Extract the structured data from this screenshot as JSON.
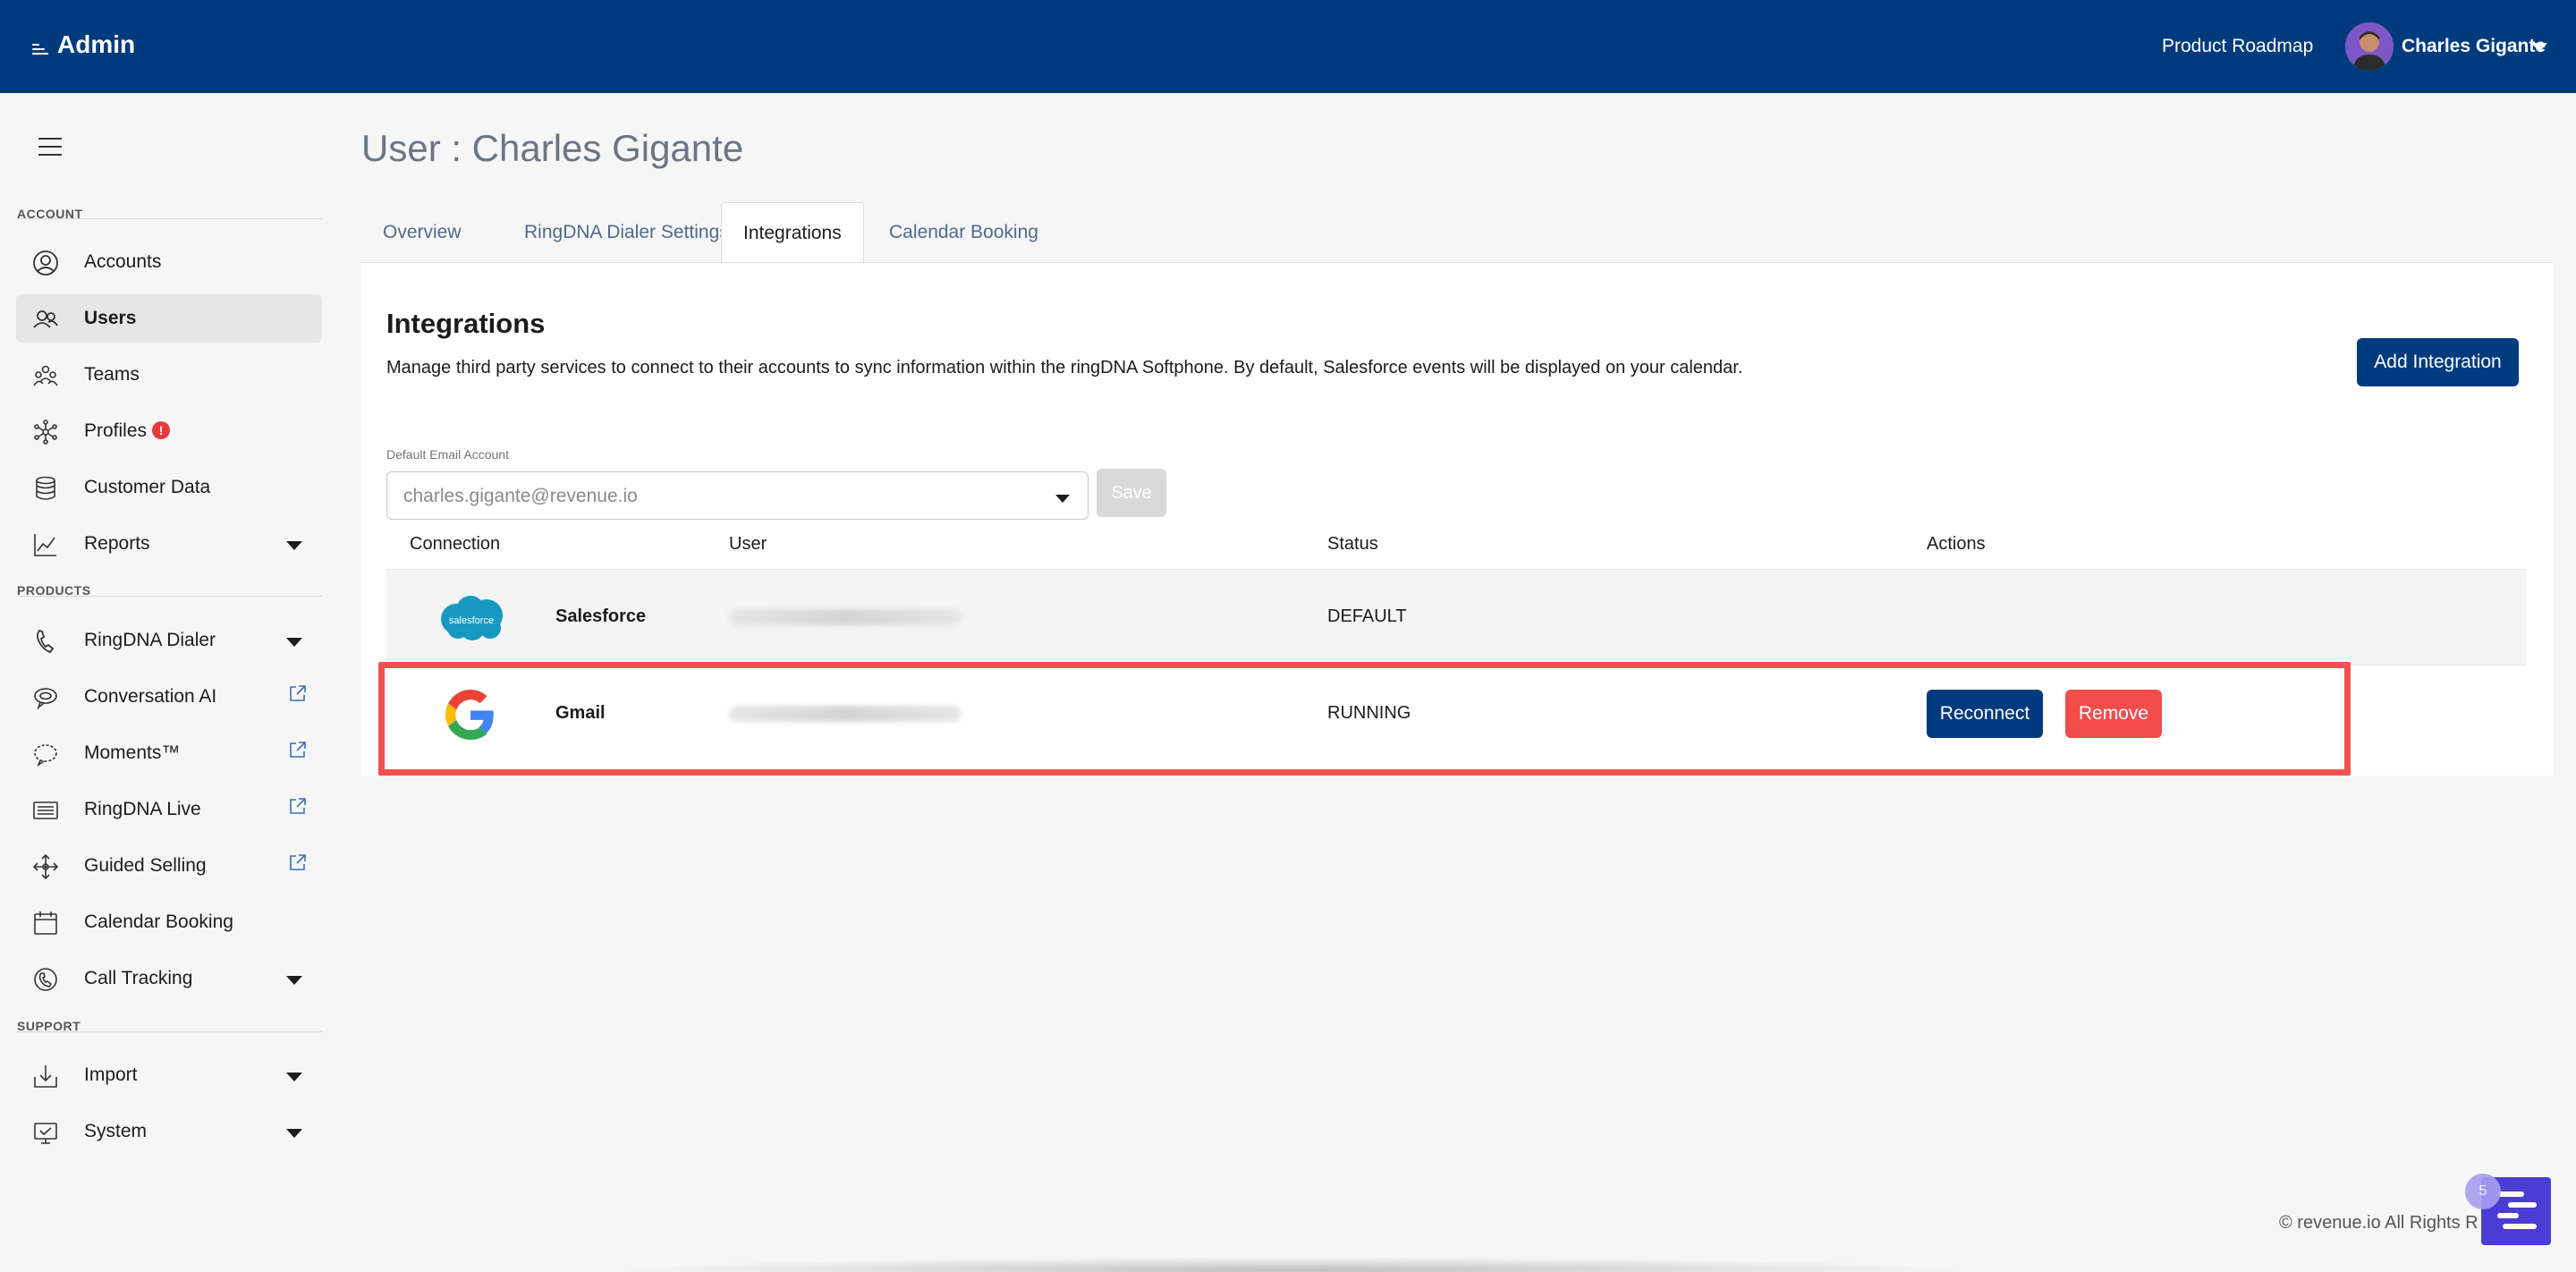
{
  "app": {
    "brand": "Admin"
  },
  "header": {
    "roadmap_link": "Product Roadmap",
    "user_name": "Charles Gigante"
  },
  "sidebar": {
    "sections": {
      "account": "ACCOUNT",
      "products": "PRODUCTS",
      "support": "SUPPORT"
    },
    "items": [
      {
        "label": "Accounts",
        "icon": "user-circle-icon"
      },
      {
        "label": "Users",
        "icon": "users-icon",
        "active": true
      },
      {
        "label": "Teams",
        "icon": "teams-icon"
      },
      {
        "label": "Profiles",
        "icon": "profiles-icon",
        "alert": "!"
      },
      {
        "label": "Customer Data",
        "icon": "database-icon"
      },
      {
        "label": "Reports",
        "icon": "chart-line-icon",
        "expandable": true
      },
      {
        "label": "RingDNA Dialer",
        "icon": "phone-icon",
        "expandable": true
      },
      {
        "label": "Conversation AI",
        "icon": "chat-bubble-icon",
        "external": true
      },
      {
        "label": "Moments™",
        "icon": "moments-icon",
        "external": true
      },
      {
        "label": "RingDNA Live",
        "icon": "live-icon",
        "external": true
      },
      {
        "label": "Guided Selling",
        "icon": "arrows-move-icon",
        "external": true
      },
      {
        "label": "Calendar Booking",
        "icon": "calendar-icon"
      },
      {
        "label": "Call Tracking",
        "icon": "call-tracking-icon",
        "expandable": true
      },
      {
        "label": "Import",
        "icon": "import-icon",
        "expandable": true
      },
      {
        "label": "System",
        "icon": "monitor-icon",
        "expandable": true
      }
    ]
  },
  "page": {
    "title": "User : Charles Gigante",
    "tabs": [
      "Overview",
      "RingDNA Dialer Settings",
      "Integrations",
      "Calendar Booking"
    ],
    "active_tab": "Integrations"
  },
  "integrations": {
    "title": "Integrations",
    "description": "Manage third party services to connect to their accounts to sync information within the ringDNA Softphone. By default, Salesforce events will be displayed on your calendar.",
    "add_button": "Add Integration",
    "default_email_label": "Default Email Account",
    "default_email_value": "charles.gigante@revenue.io",
    "save_button": "Save",
    "columns": [
      "Connection",
      "User",
      "Status",
      "Actions"
    ],
    "rows": [
      {
        "name": "Salesforce",
        "logo_text": "salesforce",
        "status": "DEFAULT"
      },
      {
        "name": "Gmail",
        "status": "RUNNING",
        "actions": [
          "Reconnect",
          "Remove"
        ]
      }
    ]
  },
  "colors": {
    "header_bg": "#003b7d",
    "primary_button": "#003b7d",
    "danger_button": "#f24c4c",
    "highlight_border": "#f2514f"
  },
  "footer": {
    "copyright": "© revenue.io All Rights R"
  },
  "chat_widget": {
    "badge": "5"
  }
}
